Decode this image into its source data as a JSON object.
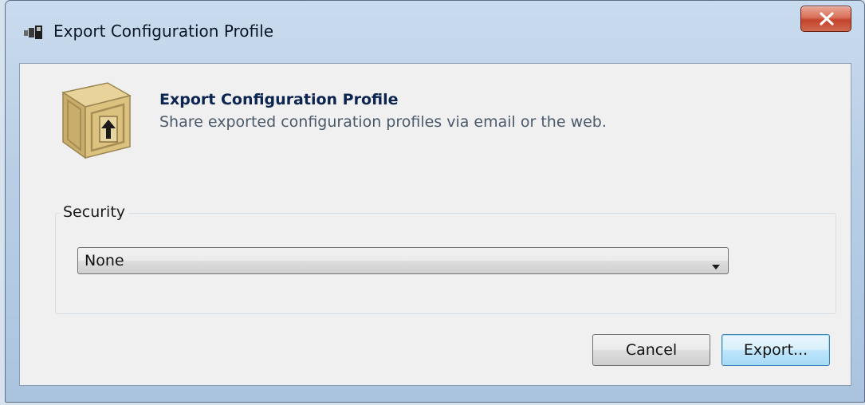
{
  "window": {
    "title": "Export Configuration Profile",
    "close_icon": "close-icon"
  },
  "header": {
    "icon": "package-export-icon",
    "title": "Export Configuration Profile",
    "subtitle": "Share exported configuration profiles via email or the web."
  },
  "security": {
    "group_label": "Security",
    "selected_value": "None"
  },
  "buttons": {
    "cancel_label": "Cancel",
    "export_label": "Export..."
  },
  "colors": {
    "close_button": "#c4432b",
    "default_button_border": "#3c7fb1",
    "header_title": "#0b2450"
  }
}
